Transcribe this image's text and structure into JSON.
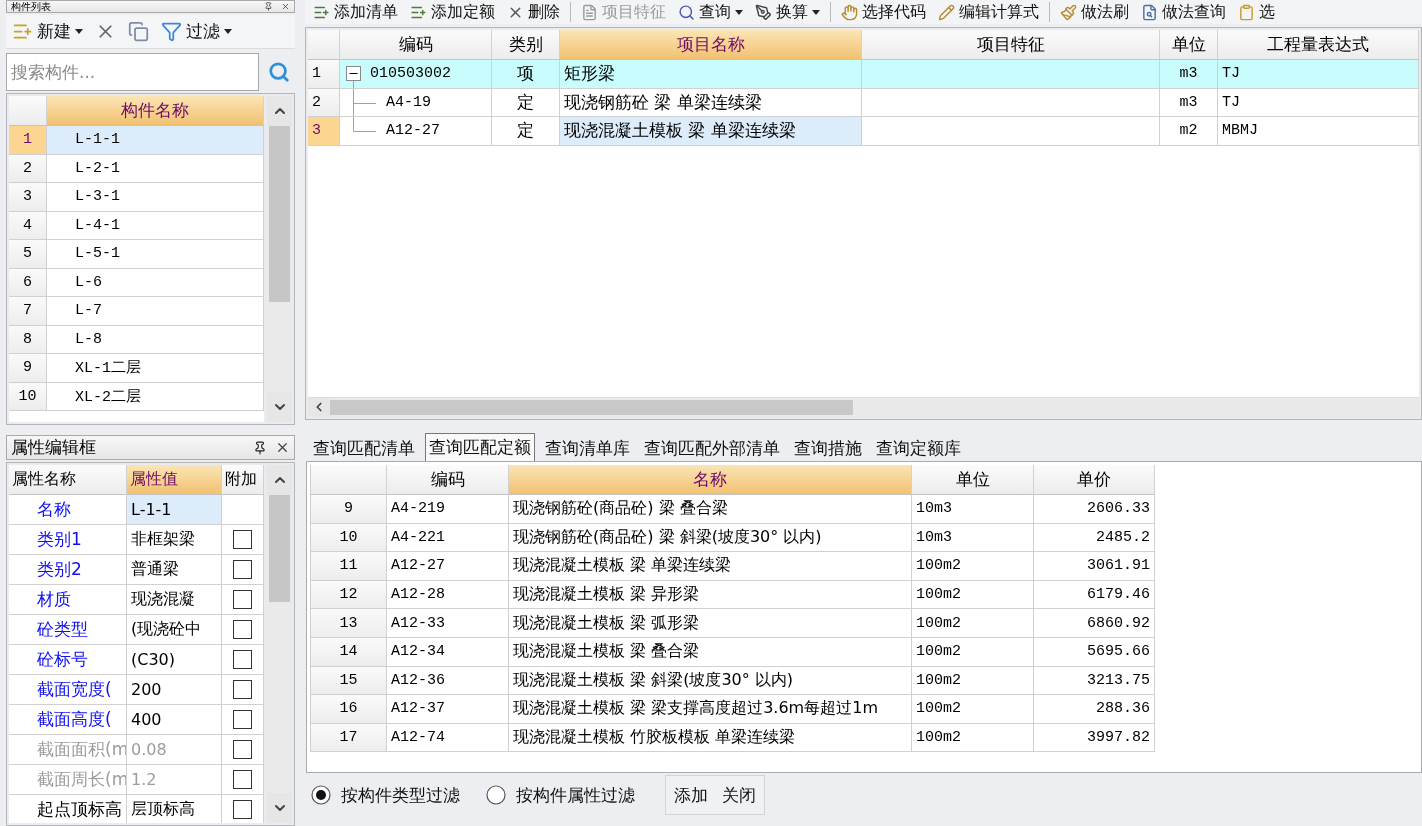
{
  "component_list": {
    "title": "构件列表",
    "toolbar": [
      {
        "label": "新建",
        "dropdown": true
      },
      {
        "dropdown": false
      },
      {
        "dropdown": false
      },
      {
        "label": "过滤",
        "dropdown": true
      }
    ],
    "search": {
      "placeholder": "搜索构件..."
    },
    "columns": [
      {
        "label": "构件名称",
        "selected": true
      }
    ],
    "rows": [
      {
        "index": "1",
        "name": "L-1-1",
        "selected": true
      },
      {
        "index": "2",
        "name": "L-2-1",
        "selected": false
      },
      {
        "index": "3",
        "name": "L-3-1",
        "selected": false
      },
      {
        "index": "4",
        "name": "L-4-1",
        "selected": false
      },
      {
        "index": "5",
        "name": "L-5-1",
        "selected": false
      },
      {
        "index": "6",
        "name": "L-6",
        "selected": false
      },
      {
        "index": "7",
        "name": "L-7",
        "selected": false
      },
      {
        "index": "8",
        "name": "L-8",
        "selected": false
      },
      {
        "index": "9",
        "name": "XL-1二层",
        "selected": false
      },
      {
        "index": "10",
        "name": "XL-2二层",
        "selected": false
      }
    ]
  },
  "property_editor": {
    "title": "属性编辑框",
    "columns": [
      {
        "label": "属性名称",
        "selected": false
      },
      {
        "label": "属性值",
        "selected": true
      },
      {
        "label": "附加",
        "selected": false
      }
    ],
    "rows": [
      {
        "name": "名称",
        "value": "L-1-1",
        "public": true,
        "disabled": false,
        "selected": true
      },
      {
        "name": "类别1",
        "value": "非框架梁",
        "public": true,
        "disabled": false,
        "selected": false,
        "checked": false
      },
      {
        "name": "类别2",
        "value": "普通梁",
        "public": true,
        "disabled": false,
        "selected": false,
        "checked": false
      },
      {
        "name": "材质",
        "value": "现浇混凝",
        "public": true,
        "disabled": false,
        "selected": false,
        "checked": false
      },
      {
        "name": "砼类型",
        "value": "(现浇砼中",
        "public": true,
        "disabled": false,
        "selected": false,
        "checked": false
      },
      {
        "name": "砼标号",
        "value": "(C30)",
        "public": true,
        "disabled": false,
        "selected": false,
        "checked": false
      },
      {
        "name": "截面宽度(",
        "value": "200",
        "public": true,
        "disabled": false,
        "selected": false,
        "checked": false
      },
      {
        "name": "截面高度(",
        "value": "400",
        "public": true,
        "disabled": false,
        "selected": false,
        "checked": false
      },
      {
        "name": "截面面积(m",
        "value": "0.08",
        "public": false,
        "disabled": true,
        "selected": false,
        "checked": false
      },
      {
        "name": "截面周长(m",
        "value": "1.2",
        "public": false,
        "disabled": true,
        "selected": false,
        "checked": false
      },
      {
        "name": "起点顶标高",
        "value": "层顶标高",
        "public": false,
        "disabled": false,
        "selected": false,
        "checked": false
      }
    ]
  },
  "toolbar": [
    [
      {
        "label": "添加清单",
        "dropdown": false,
        "disabled": false
      },
      {
        "label": "添加定额",
        "dropdown": false,
        "disabled": false
      },
      {
        "label": "删除",
        "dropdown": false,
        "disabled": false
      }
    ],
    [
      {
        "label": "项目特征",
        "dropdown": false,
        "disabled": true
      },
      {
        "label": "查询",
        "dropdown": true,
        "disabled": false
      },
      {
        "label": "换算",
        "dropdown": true,
        "disabled": false
      }
    ],
    [
      {
        "label": "选择代码",
        "dropdown": false,
        "disabled": false
      },
      {
        "label": "编辑计算式",
        "dropdown": false,
        "disabled": false
      }
    ],
    [
      {
        "label": "做法刷",
        "dropdown": false,
        "disabled": false
      },
      {
        "label": "做法查询",
        "dropdown": false,
        "disabled": false
      },
      {
        "label": "选",
        "dropdown": false,
        "disabled": false
      }
    ]
  ],
  "item_table": {
    "columns": [
      {
        "label": "编码",
        "selected": false
      },
      {
        "label": "类别",
        "selected": false
      },
      {
        "label": "项目名称",
        "selected": true
      },
      {
        "label": "项目特征",
        "selected": false
      },
      {
        "label": "单位",
        "selected": false
      },
      {
        "label": "工程量表达式",
        "selected": false
      }
    ],
    "rows": [
      {
        "index": "1",
        "code": "010503002",
        "type": "项",
        "name": "矩形梁",
        "unit": "m3",
        "expression": "TJ",
        "expanded": true,
        "selected": false,
        "children": [
          {
            "index": "2",
            "code": "A4-19",
            "type": "定",
            "name": "现浇钢筋砼 梁 单梁连续梁",
            "unit": "m3",
            "expression": "TJ",
            "selected": false
          },
          {
            "index": "3",
            "code": "A12-27",
            "type": "定",
            "name": "现浇混凝土模板 梁 单梁连续梁",
            "unit": "m2",
            "expression": "MBMJ",
            "selected": true
          }
        ]
      }
    ]
  },
  "query_tabs": [
    {
      "label": "查询匹配清单",
      "selected": false
    },
    {
      "label": "查询匹配定额",
      "selected": true
    },
    {
      "label": "查询清单库",
      "selected": false
    },
    {
      "label": "查询匹配外部清单",
      "selected": false
    },
    {
      "label": "查询措施",
      "selected": false
    },
    {
      "label": "查询定额库",
      "selected": false
    }
  ],
  "quota_table": {
    "columns": [
      {
        "label": "编码",
        "selected": false
      },
      {
        "label": "名称",
        "selected": true
      },
      {
        "label": "单位",
        "selected": false
      },
      {
        "label": "单价",
        "selected": false
      }
    ],
    "rows": [
      {
        "index": "9",
        "code": "A4-219",
        "name": "现浇钢筋砼(商品砼) 梁 叠合梁",
        "unit": "10m3",
        "price": "2606.33"
      },
      {
        "index": "10",
        "code": "A4-221",
        "name": "现浇钢筋砼(商品砼) 梁 斜梁(坡度30° 以内)",
        "unit": "10m3",
        "price": "2485.2"
      },
      {
        "index": "11",
        "code": "A12-27",
        "name": "现浇混凝土模板 梁 单梁连续梁",
        "unit": "100m2",
        "price": "3061.91"
      },
      {
        "index": "12",
        "code": "A12-28",
        "name": "现浇混凝土模板 梁 异形梁",
        "unit": "100m2",
        "price": "6179.46"
      },
      {
        "index": "13",
        "code": "A12-33",
        "name": "现浇混凝土模板 梁 弧形梁",
        "unit": "100m2",
        "price": "6860.92"
      },
      {
        "index": "14",
        "code": "A12-34",
        "name": "现浇混凝土模板 梁 叠合梁",
        "unit": "100m2",
        "price": "5695.66"
      },
      {
        "index": "15",
        "code": "A12-36",
        "name": "现浇混凝土模板 梁 斜梁(坡度30° 以内)",
        "unit": "100m2",
        "price": "3213.75"
      },
      {
        "index": "16",
        "code": "A12-37",
        "name": "现浇混凝土模板 梁 梁支撑高度超过3.6m每超过1m",
        "unit": "100m2",
        "price": "288.36"
      },
      {
        "index": "17",
        "code": "A12-74",
        "name": "现浇混凝土模板 竹胶板模板 单梁连续梁",
        "unit": "100m2",
        "price": "3997.82"
      }
    ]
  },
  "filter_options": [
    {
      "label": "按构件类型过滤",
      "selected": true
    },
    {
      "label": "按构件属性过滤",
      "selected": false
    }
  ],
  "actions": [
    "添加",
    "关闭"
  ]
}
